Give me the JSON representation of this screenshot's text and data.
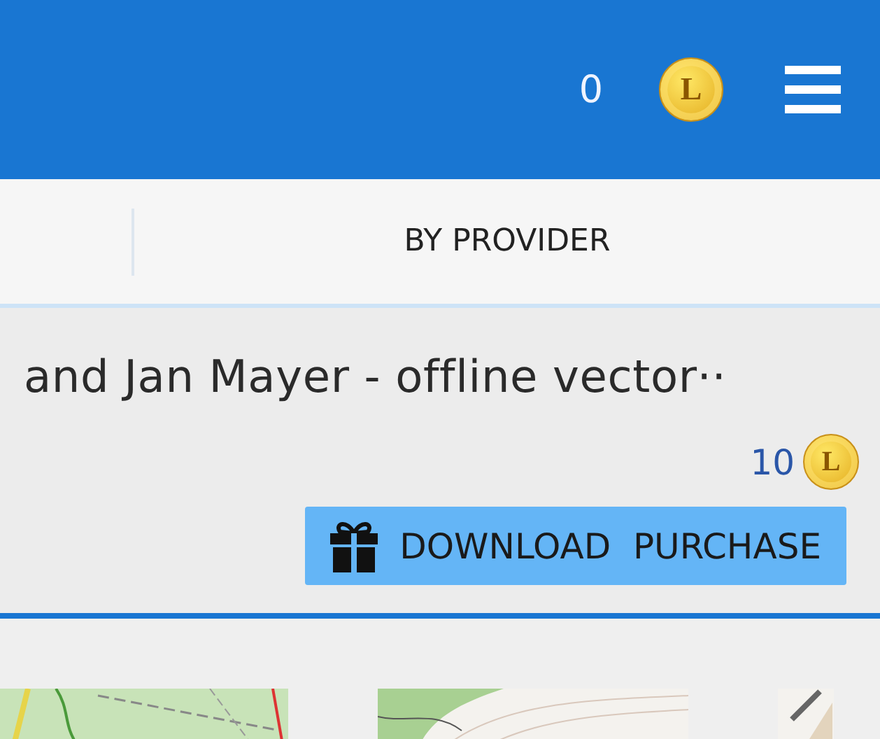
{
  "header": {
    "coin_count": "0",
    "coin_symbol": "L"
  },
  "tabs": [
    {
      "label": "BY PROVIDER",
      "selected": false
    }
  ],
  "item": {
    "title": "and Jan Mayer - offline vector··",
    "price": "10",
    "price_coin_symbol": "L",
    "button": "DOWNLOAD  PURCHASE"
  }
}
